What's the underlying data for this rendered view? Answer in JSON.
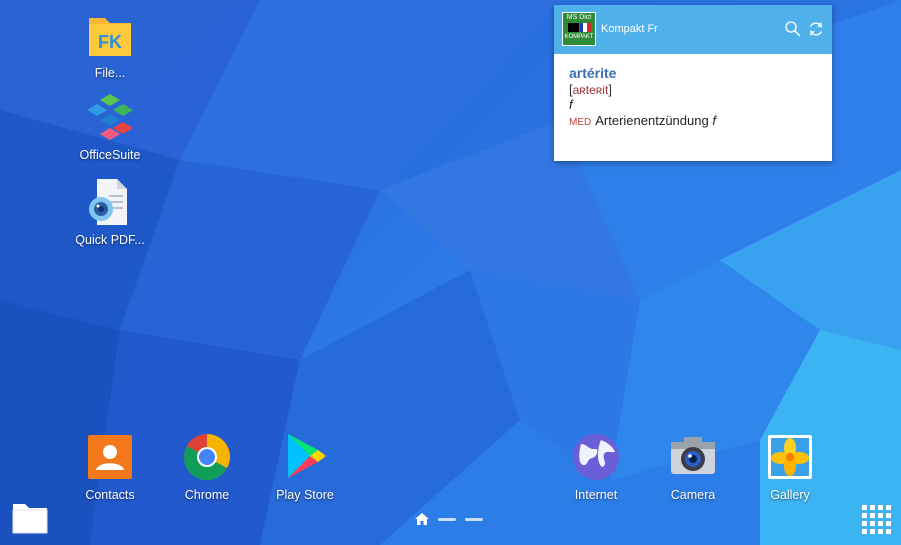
{
  "desktop_shortcuts": [
    {
      "label": "File..."
    },
    {
      "label": "OfficeSuite"
    },
    {
      "label": "Quick PDF..."
    }
  ],
  "widget": {
    "app_logo_line1": "MS Dict",
    "app_logo_line2": "KOMPAKT",
    "title": "Kompakt Fr",
    "entry": {
      "headword": "artérite",
      "phonetic_open": "[",
      "phonetic": "aʀteʀit",
      "phonetic_close": "]",
      "gender": "f",
      "domain_tag": "MED",
      "translation": "Arterienentzündung",
      "translation_gender": "f"
    }
  },
  "dock": {
    "left": [
      {
        "label": "Contacts"
      },
      {
        "label": "Chrome"
      },
      {
        "label": "Play Store"
      }
    ],
    "right": [
      {
        "label": "Internet"
      },
      {
        "label": "Camera"
      },
      {
        "label": "Gallery"
      }
    ]
  },
  "colors": {
    "widget_header": "#4fb0ea",
    "contacts": "#f3781c",
    "headword": "#3a6fb0"
  }
}
